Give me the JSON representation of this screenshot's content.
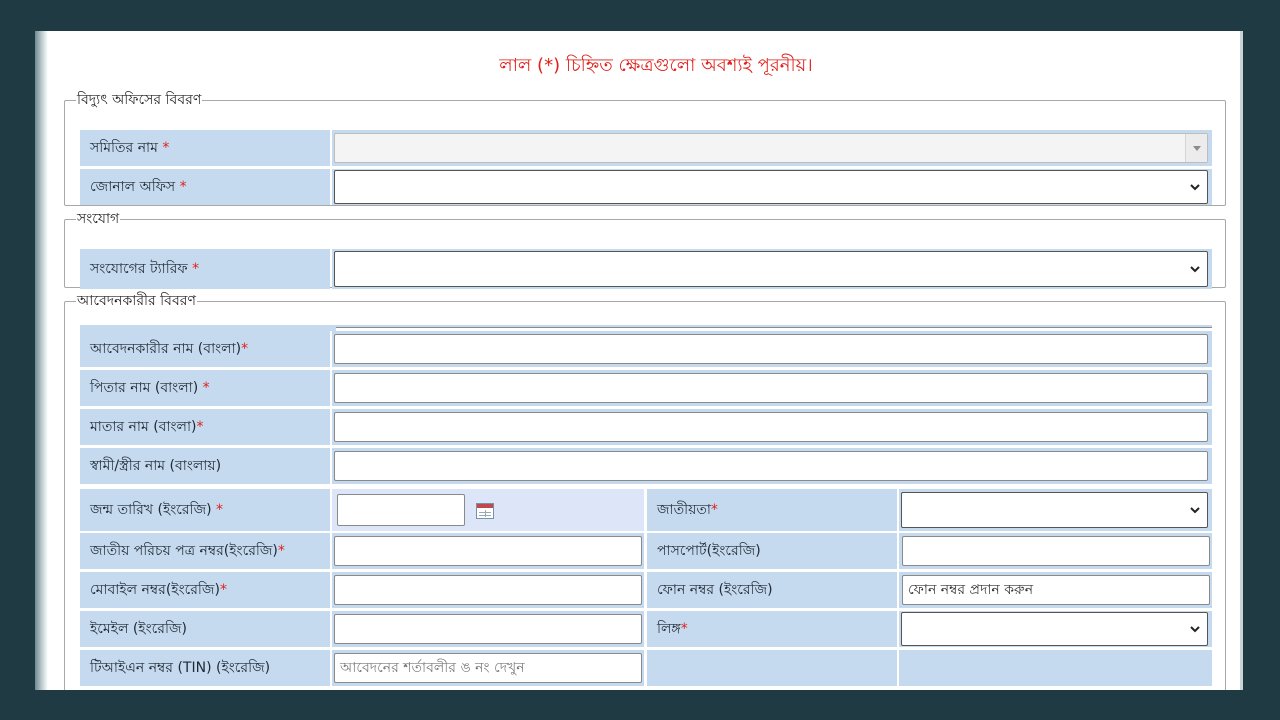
{
  "notice": "লাল (*) চিহ্নিত ক্ষেত্রগুলো অবশ্যই পূরনীয়।",
  "required_mark": "*",
  "office_section": {
    "legend": "বিদ্যুৎ অফিসের বিবরণ",
    "samity_label": "সমিতির নাম",
    "zonal_label": "জোনাল অফিস"
  },
  "connection_section": {
    "legend": "সংযোগ",
    "tariff_label": "সংযোগের ট্যারিফ"
  },
  "applicant_section": {
    "legend": "আবেদনকারীর বিবরণ",
    "name_bn_label": "আবেদনকারীর নাম (বাংলা)",
    "father_label": "পিতার নাম (বাংলা) ",
    "mother_label": "মাতার নাম (বাংলা)",
    "spouse_label": "স্বামী/স্ত্রীর নাম (বাংলায়)",
    "dob_label": "জন্ম তারিখ (ইংরেজি) ",
    "nationality_label": "জাতীয়তা",
    "nid_label": "জাতীয় পরিচয় পত্র নম্বর(ইংরেজি)",
    "passport_label": "পাসপোর্ট(ইংরেজি)",
    "mobile_label": "মোবাইল নম্বর(ইংরেজি)",
    "phone_label": "ফোন নম্বর (ইংরেজি)",
    "phone_placeholder": "ফোন নম্বর প্রদান করুন",
    "email_label": "ইমেইল (ইংরেজি)",
    "gender_label": "লিঙ্গ",
    "tin_label": "টিআইএন নম্বর (TIN) (ইংরেজি)",
    "tin_placeholder": "আবেদনের শর্তাবলীর ঙ নং দেখুন"
  }
}
